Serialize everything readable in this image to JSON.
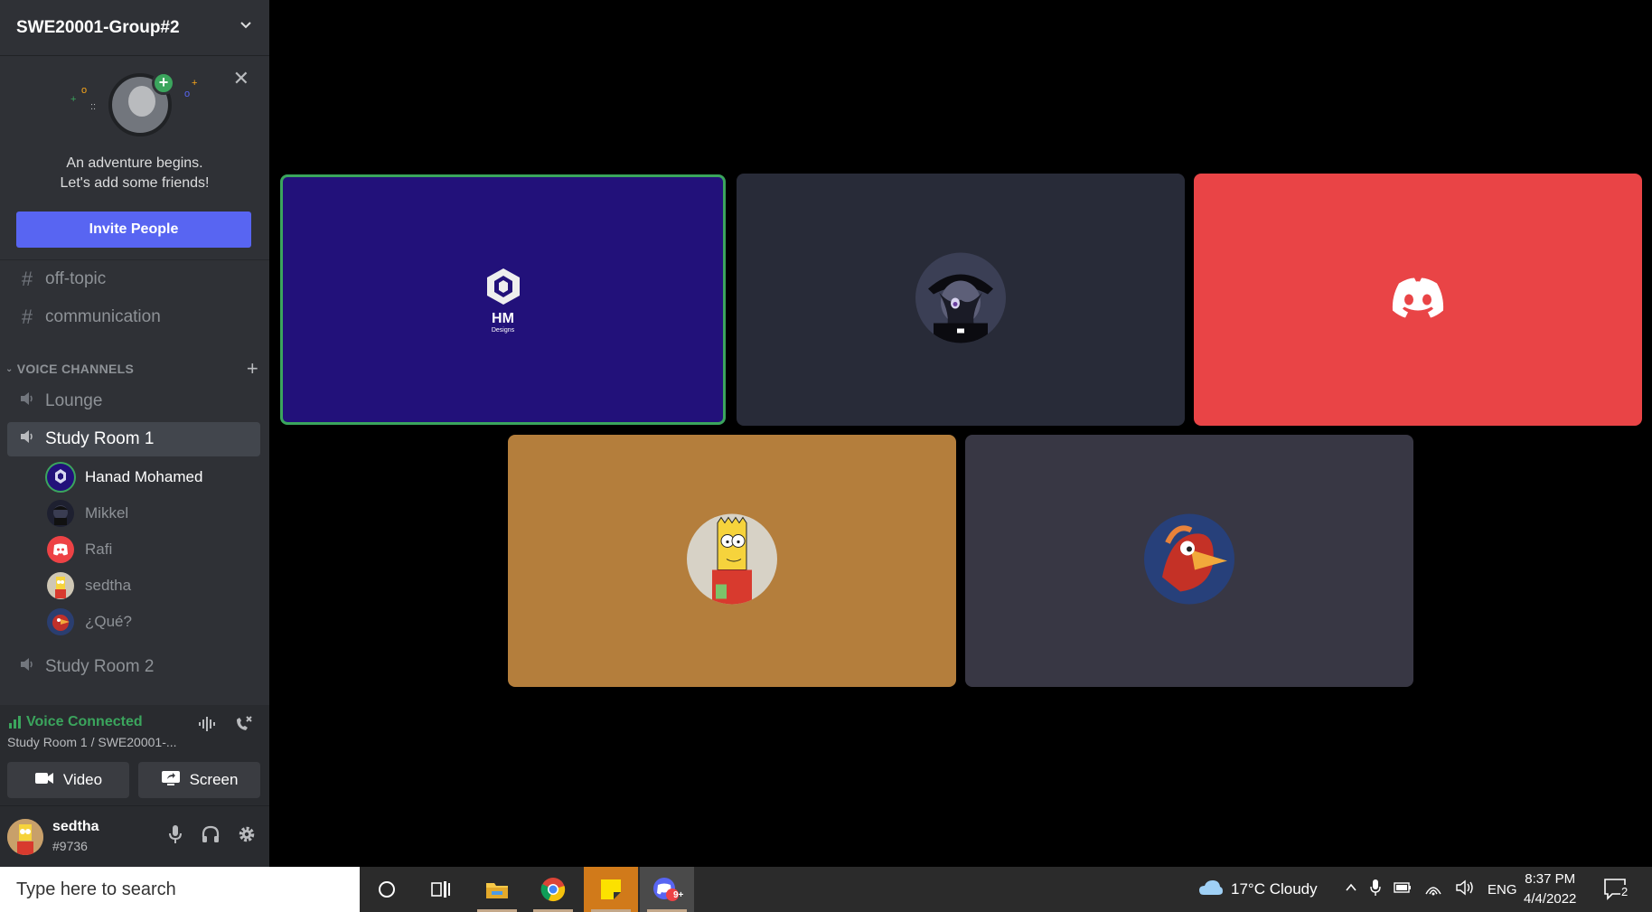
{
  "server": {
    "name": "SWE20001-Group#2"
  },
  "invite": {
    "line1": "An adventure begins.",
    "line2": "Let's add some friends!",
    "button": "Invite People"
  },
  "text_channels": [
    {
      "name": "off-topic"
    },
    {
      "name": "communication"
    }
  ],
  "voice_header": "VOICE CHANNELS",
  "voice_channels": [
    {
      "name": "Lounge"
    },
    {
      "name": "Study Room 1"
    },
    {
      "name": "Study Room 2"
    }
  ],
  "members": [
    {
      "name": "Hanad Mohamed"
    },
    {
      "name": "Mikkel"
    },
    {
      "name": "Rafi"
    },
    {
      "name": "sedtha"
    },
    {
      "name": "¿Qué?"
    }
  ],
  "voice_panel": {
    "status": "Voice Connected",
    "location": "Study Room 1 / SWE20001-...",
    "video": "Video",
    "screen": "Screen"
  },
  "user": {
    "name": "sedtha",
    "tag": "#9736"
  },
  "tiles": [
    {
      "color": "#22117a",
      "logo_text": "HM",
      "logo_sub": "Designs"
    },
    {
      "color": "#282b38"
    },
    {
      "color": "#e94446"
    },
    {
      "color": "#b47e3c"
    },
    {
      "color": "#383744"
    }
  ],
  "taskbar": {
    "search_placeholder": "Type here to search",
    "weather": "17°C  Cloudy",
    "lang": "ENG",
    "time": "8:37 PM",
    "date": "4/4/2022",
    "discord_badge": "9+",
    "notif_count": "2"
  }
}
